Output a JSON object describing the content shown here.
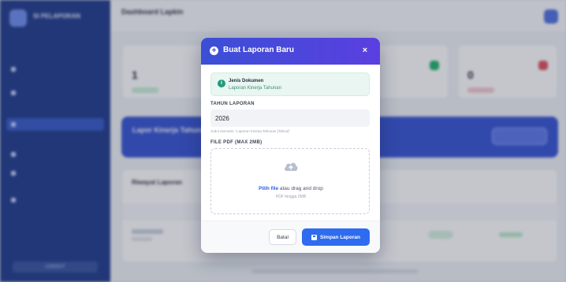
{
  "background": {
    "sidebar": {
      "brand": "SI PELAPORAN",
      "logout_label": "LOGOUT"
    },
    "topbar": {
      "title": "Dashboard Lapkin"
    },
    "banner": {
      "title": "Lapor Kinerja Tahunan"
    },
    "table": {
      "title": "Riwayat Laporan"
    }
  },
  "modal": {
    "title": "Buat Laporan Baru",
    "close_icon": "×",
    "info": {
      "title": "Jenis Dokumen",
      "value": "Laporan Kinerja Tahunan"
    },
    "year_field": {
      "label": "TAHUN LAPORAN",
      "value": "2026",
      "hint": "Judul otomatis: \"Laporan Kinerja Tahunan [Tahun]\""
    },
    "file_field": {
      "label": "FILE PDF (MAX 2MB)",
      "pick_link": "Pilih file",
      "pick_rest": " atau drag and drop",
      "sub": "PDF hingga 2MB"
    },
    "buttons": {
      "cancel": "Batal",
      "save": "Simpan Laporan"
    }
  },
  "colors": {
    "header_start": "#3b4fd6",
    "header_end": "#5b3fe0",
    "primary": "#2f6bef",
    "info_bg": "#e9f6f1",
    "info_accent": "#1e9b78"
  },
  "icons": [
    "plus-circle-icon",
    "close-icon",
    "info-icon",
    "cloud-upload-icon",
    "save-icon"
  ]
}
